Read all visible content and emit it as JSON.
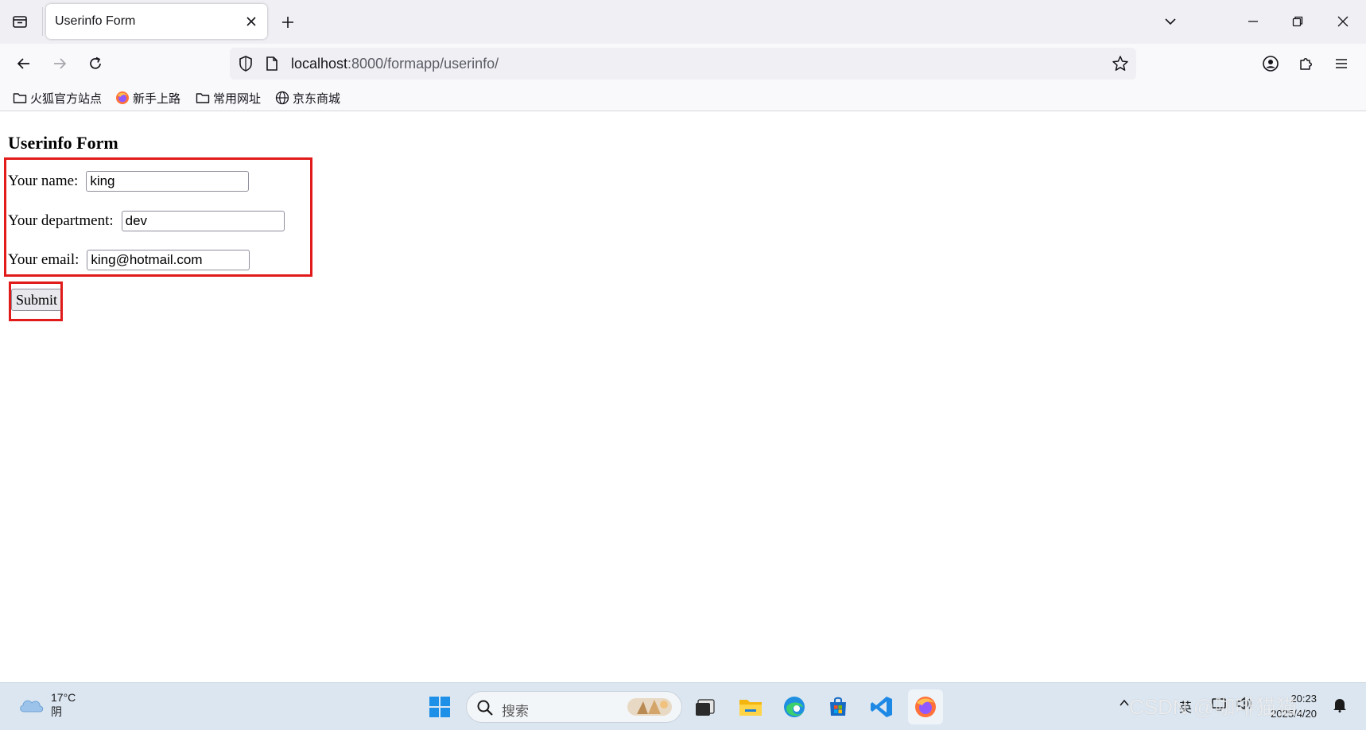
{
  "browser": {
    "tab": {
      "title": "Userinfo Form"
    },
    "url": {
      "host": "localhost",
      "path": ":8000/formapp/userinfo/"
    },
    "bookmarks": [
      {
        "label": "火狐官方站点",
        "icon": "folder-icon"
      },
      {
        "label": "新手上路",
        "icon": "firefox-icon"
      },
      {
        "label": "常用网址",
        "icon": "folder-icon"
      },
      {
        "label": "京东商城",
        "icon": "globe-icon"
      }
    ]
  },
  "page": {
    "title": "Userinfo Form",
    "fields": [
      {
        "label": "Your name:",
        "value": "king"
      },
      {
        "label": "Your department:",
        "value": "dev"
      },
      {
        "label": "Your email:",
        "value": "king@hotmail.com"
      }
    ],
    "submit_label": "Submit",
    "highlight_color": "#e11a1a"
  },
  "taskbar": {
    "weather": {
      "temp": "17°C",
      "condition": "阴"
    },
    "search_placeholder": "搜索",
    "tray": {
      "ime": "英"
    },
    "clock": {
      "time": "20:23",
      "date": "2025/4/20"
    },
    "watermark": "CSDN @咖啡猫猫."
  }
}
